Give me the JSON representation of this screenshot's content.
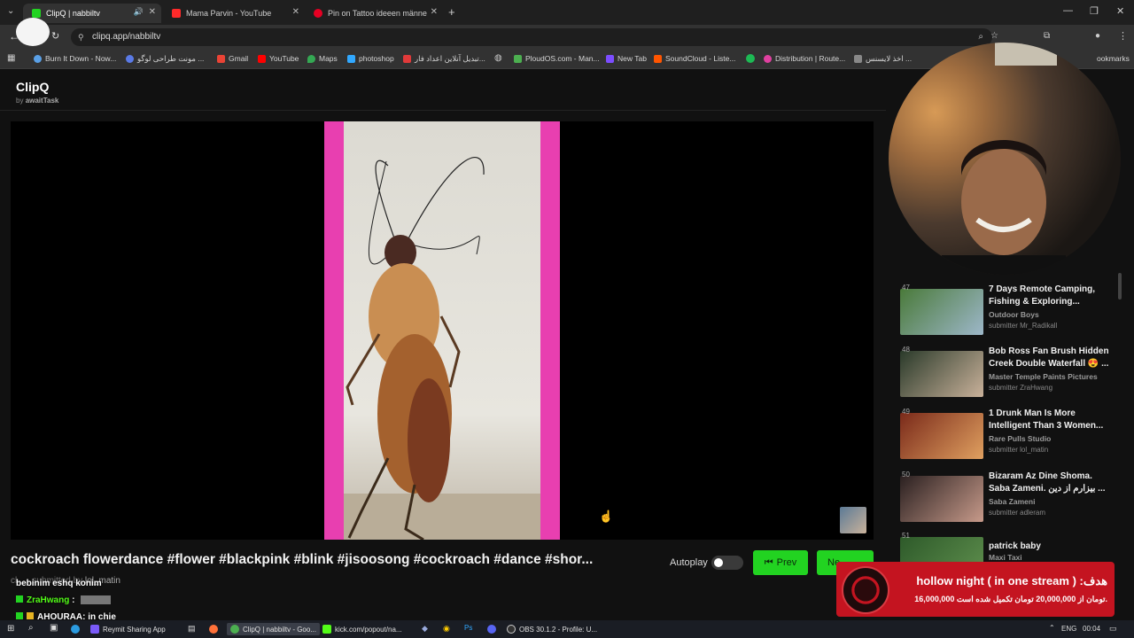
{
  "browser": {
    "tabs": [
      {
        "title": "ClipQ | nabbiltv",
        "active": true,
        "color": "#22d321"
      },
      {
        "title": "Mama Parvin - YouTube",
        "active": false,
        "color": "#ff2a2a"
      },
      {
        "title": "Pin on Tattoo ideeen männer ar",
        "active": false,
        "color": "#e60023"
      }
    ],
    "new_tab_glyph": "+",
    "url": "clipq.app/nabbiltv",
    "bookmarks": [
      {
        "label": "Burn It Down - Now...",
        "color": "#5aa0e6"
      },
      {
        "label": "مونت طراحی لوگو ...",
        "color": "#5a7ae6"
      },
      {
        "label": "Gmail",
        "color": "#ea4335"
      },
      {
        "label": "YouTube",
        "color": "#ff0000"
      },
      {
        "label": "Maps",
        "color": "#34a853"
      },
      {
        "label": "photoshop",
        "color": "#31a8ff"
      },
      {
        "label": "تبدیل آنلاین اعداد فار...",
        "color": "#e03a3a"
      },
      {
        "label": "PloudOS.com - Man...",
        "color": "#4caf50"
      },
      {
        "label": "New Tab",
        "color": "#7c4dff"
      },
      {
        "label": "SoundCloud - Liste...",
        "color": "#ff5500"
      },
      {
        "label": "Distribution | Route...",
        "color": "#e040a0"
      },
      {
        "label": "اخذ لایسنس ...",
        "color": "#888888"
      },
      {
        "label": "ookmarks",
        "color": "#aaaaaa"
      }
    ]
  },
  "app": {
    "name": "ClipQ",
    "by_prefix": "by",
    "by_name": "awaitTask"
  },
  "player": {
    "title": "cockroach flowerdance #flower #blackpink #blink #jisoosong #cockroach #dance #shor...",
    "autoplay_label": "Autoplay",
    "autoplay_on": false,
    "prev_label": "Prev",
    "next_label": "Ne",
    "submitter_partial": "cl... · submitted by",
    "submitter": "lol_matin"
  },
  "queue": [
    {
      "num": "47",
      "title": "7 Days Remote Camping, Fishing & Exploring...",
      "channel": "Outdoor Boys",
      "submitter": "submitter Mr_Radikall",
      "thumb": [
        "#4a7a3a",
        "#9db7c9"
      ]
    },
    {
      "num": "48",
      "title": "Bob Ross Fan Brush Hidden Creek Double Waterfall 😍 ...",
      "channel": "Master Temple Paints Pictures",
      "submitter": "submitter ZraHwang",
      "thumb": [
        "#2a3a2a",
        "#c9b19a"
      ]
    },
    {
      "num": "49",
      "title": "1 Drunk Man Is More Intelligent Than 3 Women...",
      "channel": "Rare Pulls Studio",
      "submitter": "submitter lol_matin",
      "thumb": [
        "#7a2a1a",
        "#e0a060"
      ]
    },
    {
      "num": "50",
      "title": "Bizaram Az Dine Shoma. Saba Zameni. بیزارم از دین ...",
      "channel": "Saba Zameni",
      "submitter": "submitter adleram",
      "thumb": [
        "#2a2020",
        "#c79a8a"
      ]
    },
    {
      "num": "51",
      "title": "patrick baby",
      "channel": "Maxi Taxi",
      "submitter": "",
      "thumb": [
        "#2e5a2a",
        "#5a8a4a"
      ]
    }
  ],
  "chat": [
    {
      "user": "",
      "text": "bebinim eshq konim"
    },
    {
      "user": "ZraHwang",
      "text": ":"
    },
    {
      "user": "AHOURAA",
      "text": ": in chie"
    }
  ],
  "goal": {
    "title": "hollow night ( in one stream ) :هدف",
    "sub": "16,000,000 تومان از 20,000,000 تومان تکمیل شده است."
  },
  "taskbar": {
    "items": [
      {
        "label": "Reymit Sharing App",
        "color": "#7a5af8"
      },
      {
        "label": "ClipQ | nabbiltv - Goo...",
        "color": "#4caf50"
      },
      {
        "label": "kick.com/popout/na...",
        "color": "#53fc18"
      },
      {
        "label": "OBS 30.1.2 - Profile: U...",
        "color": "#cccccc"
      }
    ],
    "lang": "ENG",
    "time": "00:04"
  }
}
